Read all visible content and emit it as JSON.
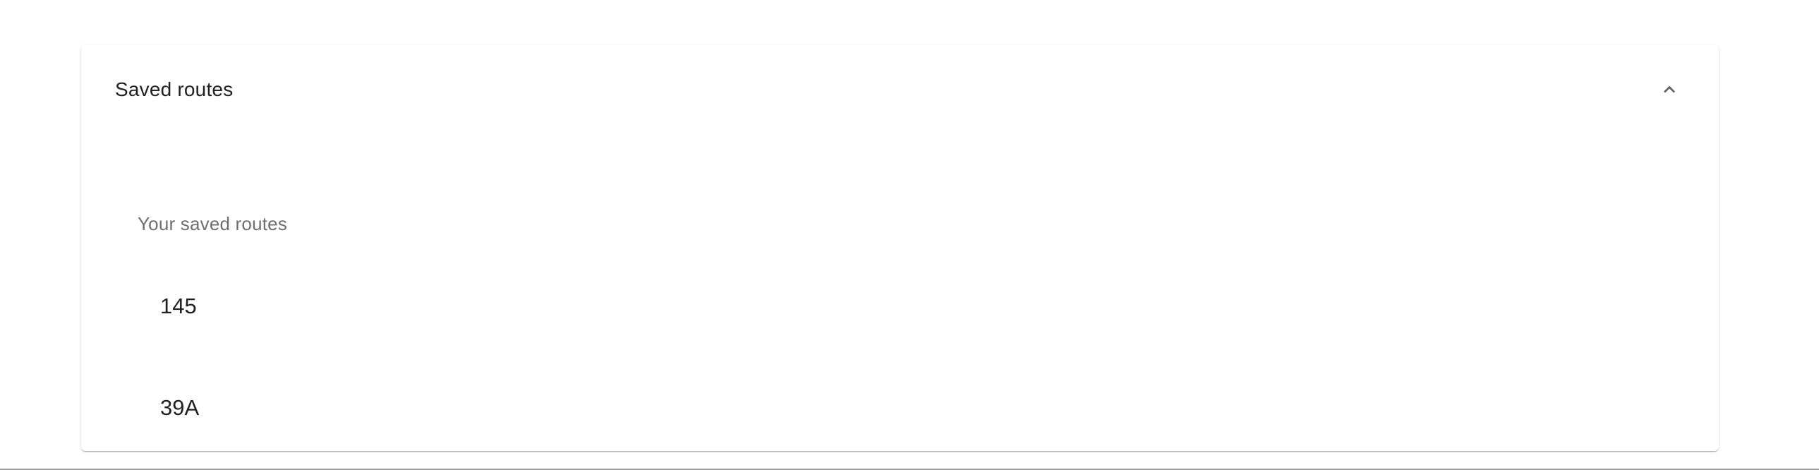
{
  "panel": {
    "title": "Saved routes",
    "expanded": true,
    "toggle_icon": "chevron-up-icon",
    "section_label": "Your saved routes",
    "routes": [
      {
        "label": "145"
      },
      {
        "label": "39A"
      }
    ]
  },
  "colors": {
    "title_text": "#212121",
    "label_text": "#6f6f6f",
    "icon": "#616161",
    "background": "#ffffff"
  }
}
